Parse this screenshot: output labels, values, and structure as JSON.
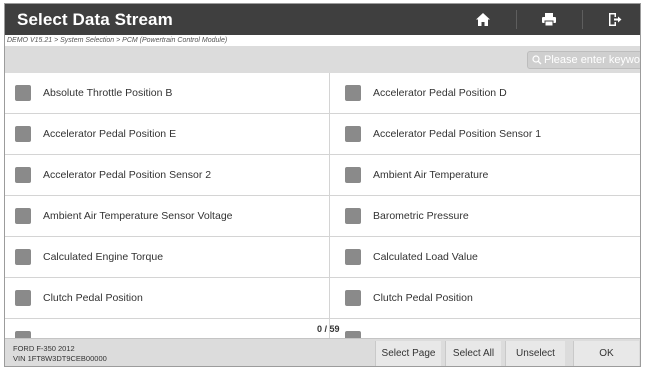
{
  "header": {
    "title": "Select Data Stream",
    "icons": [
      "home-icon",
      "print-icon",
      "exit-icon"
    ]
  },
  "breadcrumb": "DEMO V15.21 > System Selection > PCM (Powertrain Control Module)",
  "search": {
    "placeholder": "Please enter keyword"
  },
  "items": [
    {
      "label": "Absolute Throttle Position B"
    },
    {
      "label": "Accelerator Pedal Position D"
    },
    {
      "label": "Accelerator Pedal Position E"
    },
    {
      "label": "Accelerator Pedal Position Sensor 1"
    },
    {
      "label": "Accelerator Pedal Position Sensor 2"
    },
    {
      "label": "Ambient Air Temperature"
    },
    {
      "label": "Ambient Air Temperature Sensor Voltage"
    },
    {
      "label": "Barometric Pressure"
    },
    {
      "label": "Calculated Engine Torque"
    },
    {
      "label": "Calculated Load Value"
    },
    {
      "label": "Clutch Pedal Position"
    },
    {
      "label": "Clutch Pedal Position"
    }
  ],
  "counter": "0 / 59",
  "vehicle": {
    "model": "FORD F-350 2012",
    "vin": "VIN 1FT8W3DT9CEB00000"
  },
  "buttons": {
    "select_page": "Select Page",
    "select_all": "Select All",
    "unselect": "Unselect",
    "ok": "OK"
  },
  "colors": {
    "header_bg": "#3f3f3f",
    "toolbar_bg": "#dcdcdc",
    "checkbox": "#8a8a8a"
  }
}
